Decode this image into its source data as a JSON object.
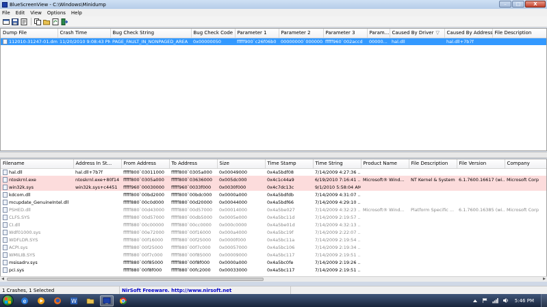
{
  "window": {
    "title": "BlueScreenView  -  C:\\Windows\\Minidump",
    "minimize": "–",
    "maximize": "□",
    "close": "X"
  },
  "menu": [
    "File",
    "Edit",
    "View",
    "Options",
    "Help"
  ],
  "toolbar_icons": [
    "html-report-icon",
    "save-icon",
    "properties-icon",
    "copy-icon",
    "open-icon",
    "refresh-icon",
    "exit-icon"
  ],
  "dumps": {
    "columns": [
      "Dump File",
      "Crash Time",
      "Bug Check String",
      "Bug Check Code",
      "Parameter 1",
      "Parameter 2",
      "Parameter 3",
      "Param...",
      "Caused By Driver",
      "Caused By Address",
      "File Description"
    ],
    "rows": [
      [
        "112010-31247-01.dmp",
        "11/20/2010 9:08:43 PM",
        "PAGE_FAULT_IN_NONPAGED_AREA",
        "0x00000050",
        "fffff900`c26f06b0",
        "00000000`000000...",
        "fffff960`002accd",
        "00000...",
        "hal.dll",
        "hal.dll+7b7f",
        ""
      ]
    ]
  },
  "drivers": {
    "columns": [
      "Filename",
      "Address In St...",
      "From Address",
      "To Address",
      "Size",
      "Time Stamp",
      "Time String",
      "Product Name",
      "File Description",
      "File Version",
      "Company"
    ],
    "rows": [
      {
        "style": "",
        "cells": [
          "hal.dll",
          "hal.dll+7b7f",
          "fffff800`03011000",
          "fffff800`0305a000",
          "0x00049000",
          "0x4a5bdf08",
          "7/14/2009 4:27:36 ...",
          "",
          "",
          "",
          ""
        ]
      },
      {
        "style": "pink",
        "cells": [
          "ntoskrnl.exe",
          "ntoskrnl.exe+80f14",
          "fffff800`0305a000",
          "fffff800`03636000",
          "0x005dc000",
          "0x4c1c44a9",
          "6/19/2010 7:16:41 ...",
          "Microsoft® Wind...",
          "NT Kernel & System",
          "6.1.7600.16617 (wi...",
          "Microsoft Corp"
        ]
      },
      {
        "style": "pink",
        "cells": [
          "win32k.sys",
          "win32k.sys+c4451",
          "fffff960`00030000",
          "fffff960`0033f000",
          "0x0030f000",
          "0x4c7dc13c",
          "9/1/2010 5:58:04 AM",
          "",
          "",
          "",
          ""
        ]
      },
      {
        "style": "",
        "cells": [
          "kdcom.dll",
          "",
          "fffff800`00bd2000",
          "fffff800`00bdc000",
          "0x0000a000",
          "0x4a5bdfdb",
          "7/14/2009 4:31:07 ...",
          "",
          "",
          "",
          ""
        ]
      },
      {
        "style": "",
        "cells": [
          "mcupdate_GenuineIntel.dll",
          "",
          "fffff880`00c0d000",
          "fffff880`00d20000",
          "0x00044000",
          "0x4a5bdf66",
          "7/14/2009 4:29:10 ...",
          "",
          "",
          "",
          ""
        ]
      },
      {
        "style": "gray",
        "cells": [
          "PSHED.dll",
          "",
          "fffff880`00d43000",
          "fffff880`00d57000",
          "0x00014000",
          "0x4a5be027",
          "7/14/2009 4:32:23 ...",
          "Microsoft® Wind...",
          "Platform Specific ...",
          "6.1.7600.16385 (wi...",
          "Microsoft Corp"
        ]
      },
      {
        "style": "gray",
        "cells": [
          "CLFS.SYS",
          "",
          "fffff880`00d57000",
          "fffff880`00db5000",
          "0x0005e000",
          "0x4a5bc11d",
          "7/14/2009 2:19:57 ...",
          "",
          "",
          "",
          ""
        ]
      },
      {
        "style": "gray",
        "cells": [
          "CI.dll",
          "",
          "fffff880`00c00000",
          "fffff880`00cc0000",
          "0x000c0000",
          "0x4a5be01d",
          "7/14/2009 4:32:13 ...",
          "",
          "",
          "",
          ""
        ]
      },
      {
        "style": "gray",
        "cells": [
          "Wdf01000.sys",
          "",
          "fffff880`00e72000",
          "fffff880`00f16000",
          "0x000a4000",
          "0x4a5bc19f",
          "7/14/2009 2:22:07 ...",
          "",
          "",
          "",
          ""
        ]
      },
      {
        "style": "gray",
        "cells": [
          "WDFLDR.SYS",
          "",
          "fffff880`00f16000",
          "fffff880`00f25000",
          "0x0000f000",
          "0x4a5bc11a",
          "7/14/2009 2:19:54 ...",
          "",
          "",
          "",
          ""
        ]
      },
      {
        "style": "gray",
        "cells": [
          "ACPI.sys",
          "",
          "fffff880`00f25000",
          "fffff880`00f7c000",
          "0x00057000",
          "0x4a5bc106",
          "7/14/2009 2:19:34 ...",
          "",
          "",
          "",
          ""
        ]
      },
      {
        "style": "gray",
        "cells": [
          "WMILIB.SYS",
          "",
          "fffff880`00f7c000",
          "fffff880`00f85000",
          "0x00009000",
          "0x4a5bc117",
          "7/14/2009 2:19:51 ...",
          "",
          "",
          "",
          ""
        ]
      },
      {
        "style": "",
        "cells": [
          "msisadrv.sys",
          "",
          "fffff880`00f85000",
          "fffff880`00f8f000",
          "0x0000a000",
          "0x4a5bc0fe",
          "7/14/2009 2:19:26 ...",
          "",
          "",
          "",
          ""
        ]
      },
      {
        "style": "",
        "cells": [
          "pci.sys",
          "",
          "fffff880`00f8f000",
          "fffff880`00fc2000",
          "0x00033000",
          "0x4a5bc117",
          "7/14/2009 2:19:51 ...",
          "",
          "",
          "",
          ""
        ]
      }
    ]
  },
  "status": {
    "count": "1 Crashes, 1 Selected",
    "freeware": "NirSoft Freeware.  http://www.nirsoft.net"
  },
  "taskbar": {
    "apps": [
      "ie-icon",
      "media-player-icon",
      "firefox-icon",
      "word-icon",
      "explorer-icon",
      "bluescreenview-icon",
      "chrome-icon"
    ],
    "clock": "5:46 PM"
  }
}
